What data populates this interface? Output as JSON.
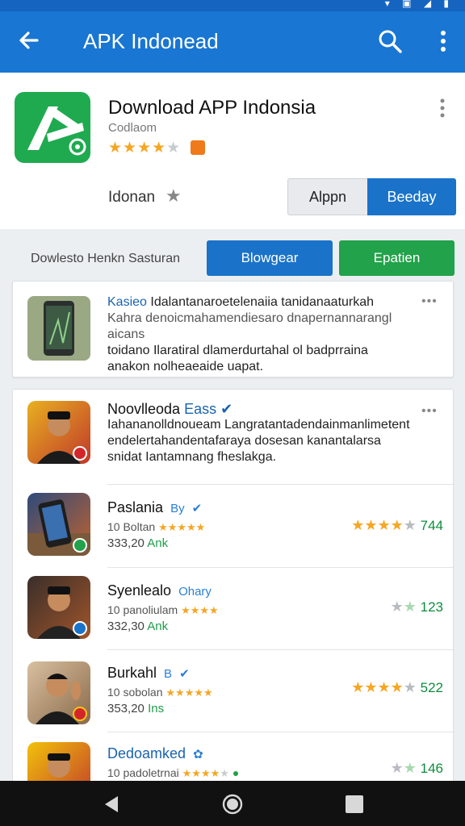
{
  "appbar": {
    "title": "APK Indonead",
    "status_icons": "▾ ▣ ◢ ▮"
  },
  "header": {
    "app_name": "Download APP Indonsia",
    "developer": "Codlaom",
    "rating_stars": "3.5 of 5",
    "meta_label": "Idonan",
    "btn_light": "Alppn",
    "btn_blue": "Beeday"
  },
  "filter": {
    "label": "Dowlesto Henkn Sasturan",
    "browse_label": "Blowgear",
    "patien_label": "Epatien"
  },
  "featured": {
    "title": "Kasieo",
    "line1_rest": "Idalantanaroetelenaiia tanidanaaturkah",
    "line2": "Kahra denoicmahamendiesaro dnapernannarangl aicans",
    "line3": "toidano Ilaratiral dlamerdurtahal ol badprraina",
    "line4": "anakon nolheaeaide uapat."
  },
  "list": [
    {
      "title": "Noovlleoda",
      "title_blue": "Eass",
      "verified": "✔",
      "desc1": "Iahananolldnoueam Langratantadendainmanlimetent",
      "desc2": "endelertahandentafaraya dosesan kanantalarsa",
      "desc3": "snidat Iantamnang fheslakga.",
      "badge_color": "#d3262a"
    },
    {
      "title": "Paslania",
      "title_blue": "By",
      "verified": "✔",
      "sub": "10 Boltan",
      "stars": "5.0",
      "size": "333,20",
      "size_unit": "Ank",
      "rating_value": "4.0",
      "rating_count": "744",
      "badge_color": "#22a24a"
    },
    {
      "title": "Syenlealo",
      "title_blue": "Ohary",
      "sub": "10 panoliulam",
      "stars": "3.5",
      "size": "332,30",
      "size_unit": "Ank",
      "rating_value": "1.0",
      "rating_count": "123",
      "badge_color": "#1a73c9"
    },
    {
      "title": "Burkahl",
      "title_blue": "B",
      "verified": "✔",
      "sub": "10 sobolan",
      "stars": "4.5",
      "size": "353,20",
      "size_unit": "Ins",
      "rating_value": "4.0",
      "rating_count": "522",
      "badge_color": "#d3262a"
    },
    {
      "title": "Dedoamked",
      "title_blue": "",
      "verified": "✿",
      "sub": "10 padoletrnai",
      "stars": "4.0",
      "rating_value": "1.0",
      "rating_count": "146",
      "badge_color": "#22a24a"
    }
  ],
  "colors": {
    "appbar": "#1976d2",
    "accent_blue": "#1a73c9",
    "accent_green": "#22a24a",
    "star": "#f5a623"
  }
}
